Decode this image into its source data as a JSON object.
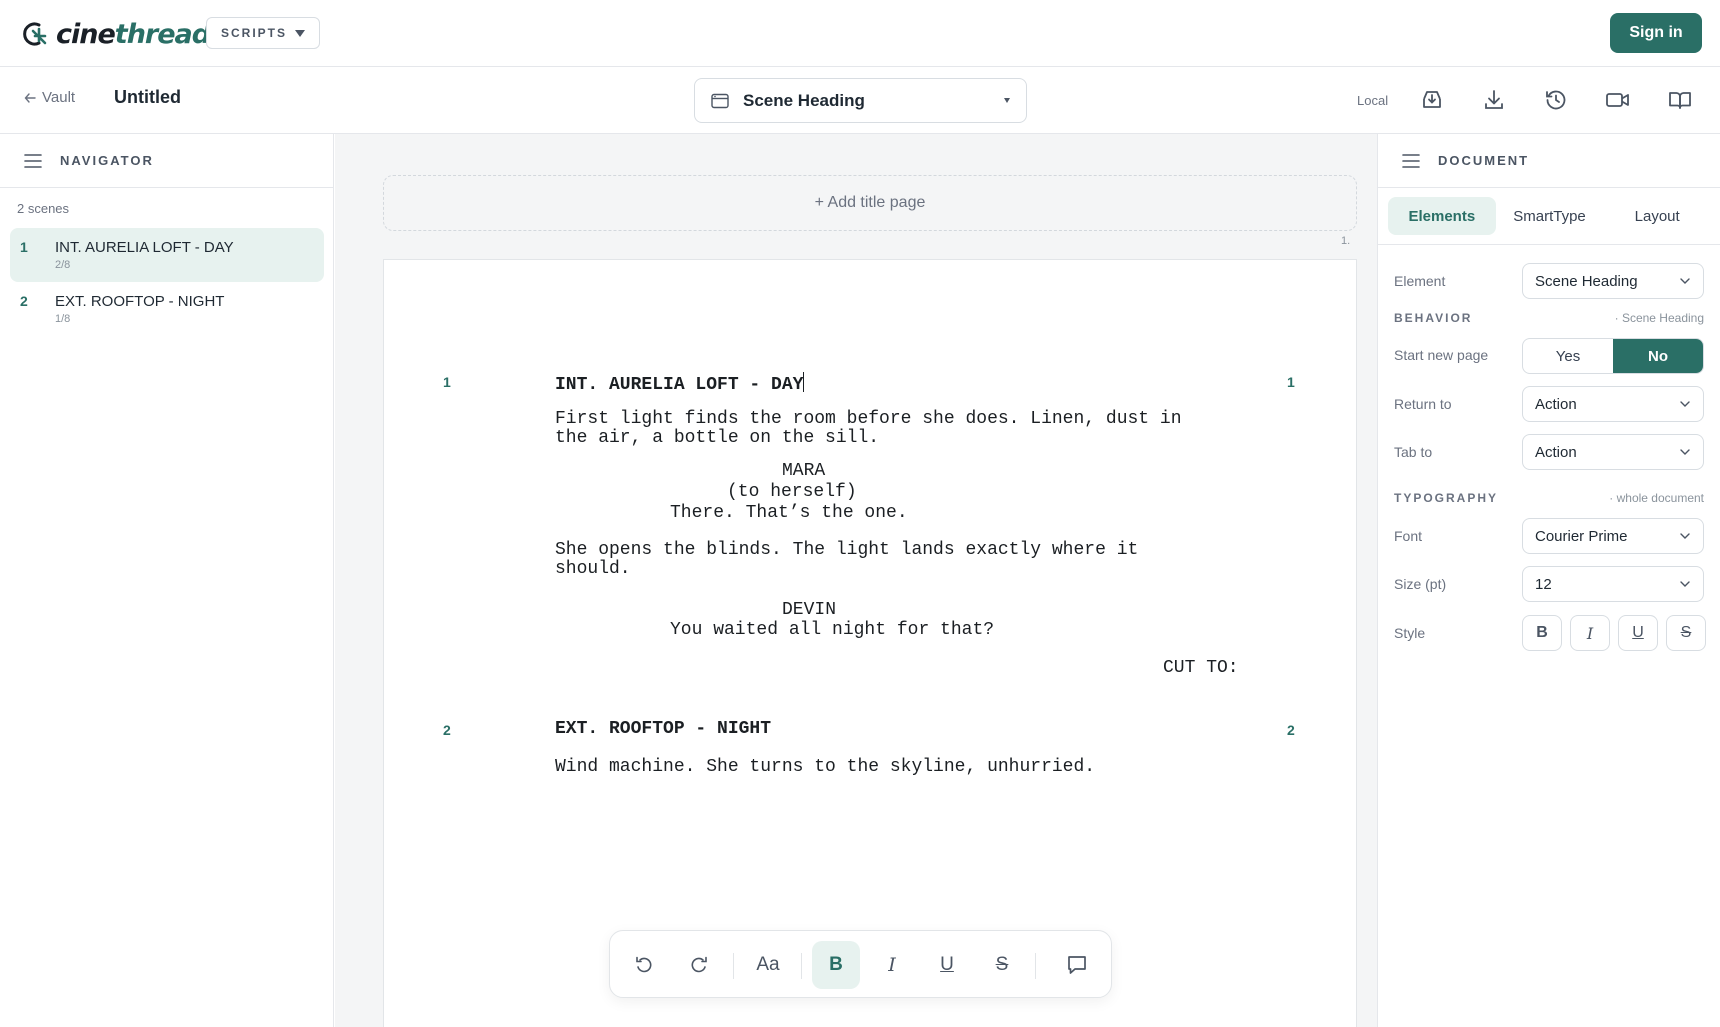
{
  "app": {
    "logo_prefix": "cine",
    "logo_accent": "thread",
    "scripts_label": "SCRIPTS",
    "sign_in_label": "Sign in",
    "brand_color": "#2a6f66"
  },
  "subbar": {
    "back_label": "Vault",
    "doc_title": "Untitled",
    "element_type": "Scene Heading",
    "storage_label": "Local"
  },
  "navigator": {
    "title": "NAVIGATOR",
    "scene_count": "2 scenes",
    "scenes": [
      {
        "num": "1",
        "name": "INT. AURELIA LOFT - DAY",
        "length": "2/8"
      },
      {
        "num": "2",
        "name": "EXT. ROOFTOP - NIGHT",
        "length": "1/8"
      }
    ]
  },
  "editor": {
    "add_title_page": "+ Add title page",
    "page_number": "1.",
    "lines": {
      "heading1": "INT. AURELIA LOFT - DAY",
      "action1a": "First light finds the room before she does. Linen, dust in",
      "action1b": "the air, a bottle on the sill.",
      "char1": "MARA",
      "paren1": "(to herself)",
      "dialog1": "There. That’s the one.",
      "action2a": "She opens the blinds. The light lands exactly where it",
      "action2b": "should.",
      "char2": "DEVIN",
      "dialog2": "You waited all night for that?",
      "transition": "CUT TO:",
      "heading2": "EXT. ROOFTOP - NIGHT",
      "action3": "Wind machine. She turns to the skyline, unhurried."
    },
    "scene_numbers": [
      "1",
      "2"
    ]
  },
  "toolbar": {
    "case_label": "Aa",
    "bold_label": "B",
    "italic_label": "I",
    "underline_label": "U",
    "strike_label": "S"
  },
  "document": {
    "title": "DOCUMENT",
    "tabs": [
      "Elements",
      "SmartType",
      "Layout"
    ],
    "element_label": "Element",
    "element_value": "Scene Heading",
    "behavior_label": "BEHAVIOR",
    "behavior_note": "· Scene Heading",
    "start_new_page_label": "Start new page",
    "yes_label": "Yes",
    "no_label": "No",
    "return_to_label": "Return to",
    "return_to_value": "Action",
    "tab_to_label": "Tab to",
    "tab_to_value": "Action",
    "typography_label": "TYPOGRAPHY",
    "typography_note": "· whole document",
    "font_label": "Font",
    "font_value": "Courier Prime",
    "size_label": "Size (pt)",
    "size_value": "12",
    "style_label": "Style",
    "style_bold": "B",
    "style_italic": "I",
    "style_underline": "U",
    "style_strike": "S"
  }
}
